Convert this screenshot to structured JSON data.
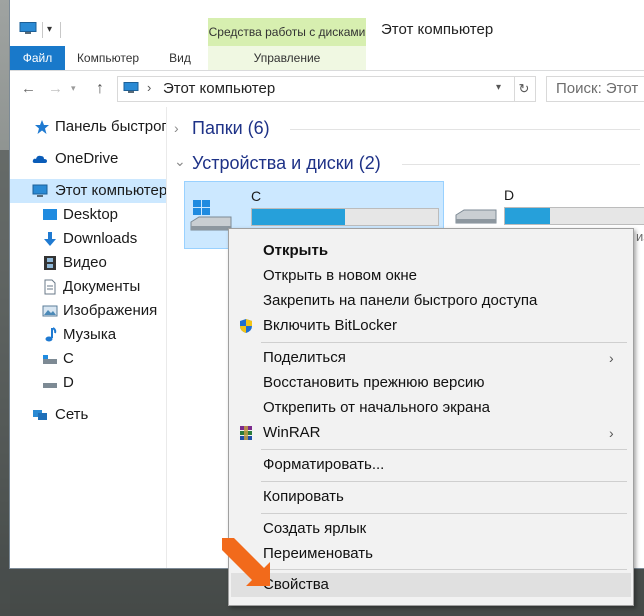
{
  "window": {
    "title": "Этот компьютер",
    "ribbon_tabs": {
      "file": "Файл",
      "computer": "Компьютер",
      "view": "Вид",
      "manage": "Управление"
    },
    "contextual_group": "Средства работы с дисками",
    "qat_dropdown": "▾"
  },
  "address_bar": {
    "back": "←",
    "forward": "→",
    "recent": "▾",
    "up": "↑",
    "chevron": "›",
    "path": "Этот компьютер",
    "dropdown": "▾",
    "refresh": "↻",
    "search_placeholder": "Поиск: Этот"
  },
  "nav_pane": {
    "items": [
      {
        "label": "Панель быстрого доступа",
        "icon": "star-icon"
      },
      {
        "label": "OneDrive",
        "icon": "cloud-icon"
      },
      {
        "label": "Этот компьютер",
        "icon": "computer-icon",
        "selected": true
      },
      {
        "label": "Desktop",
        "icon": "desktop-icon"
      },
      {
        "label": "Downloads",
        "icon": "download-arrow-icon"
      },
      {
        "label": "Видео",
        "icon": "film-icon"
      },
      {
        "label": "Документы",
        "icon": "document-icon"
      },
      {
        "label": "Изображения",
        "icon": "picture-icon"
      },
      {
        "label": "Музыка",
        "icon": "music-note-icon"
      },
      {
        "label": "C",
        "icon": "drive-icon"
      },
      {
        "label": "D",
        "icon": "drive-icon"
      },
      {
        "label": "Сеть",
        "icon": "network-icon"
      }
    ]
  },
  "content": {
    "folders_group": {
      "label": "Папки (6)",
      "chevron": "›"
    },
    "devices_group": {
      "label": "Устройства и диски (2)",
      "chevron": "⌄"
    },
    "drives": [
      {
        "name": "C",
        "used_fraction": 0.5,
        "selected": true,
        "free_text": ""
      },
      {
        "name": "D",
        "used_fraction": 0.3,
        "selected": false,
        "free_text": "из"
      }
    ]
  },
  "context_menu": {
    "items": [
      {
        "label": "Открыть",
        "bold": true
      },
      {
        "label": "Открыть в новом окне"
      },
      {
        "label": "Закрепить на панели быстрого доступа"
      },
      {
        "label": "Включить BitLocker",
        "icon": "shield-icon"
      },
      {
        "label": "Поделиться",
        "submenu": true
      },
      {
        "label": "Восстановить прежнюю версию"
      },
      {
        "label": "Открепить от начального экрана"
      },
      {
        "label": "WinRAR",
        "icon": "winrar-icon",
        "submenu": true
      },
      {
        "label": "Форматировать..."
      },
      {
        "label": "Копировать"
      },
      {
        "label": "Создать ярлык"
      },
      {
        "label": "Переименовать"
      },
      {
        "label": "Свойства",
        "hovered": true
      }
    ],
    "submenu_arrow": "›"
  },
  "colors": {
    "accent": "#1979ca",
    "selection": "#cce8ff",
    "drive_bar": "#26a0da",
    "tools_band": "#d7efb0",
    "annotation_arrow": "#f26a1b"
  }
}
